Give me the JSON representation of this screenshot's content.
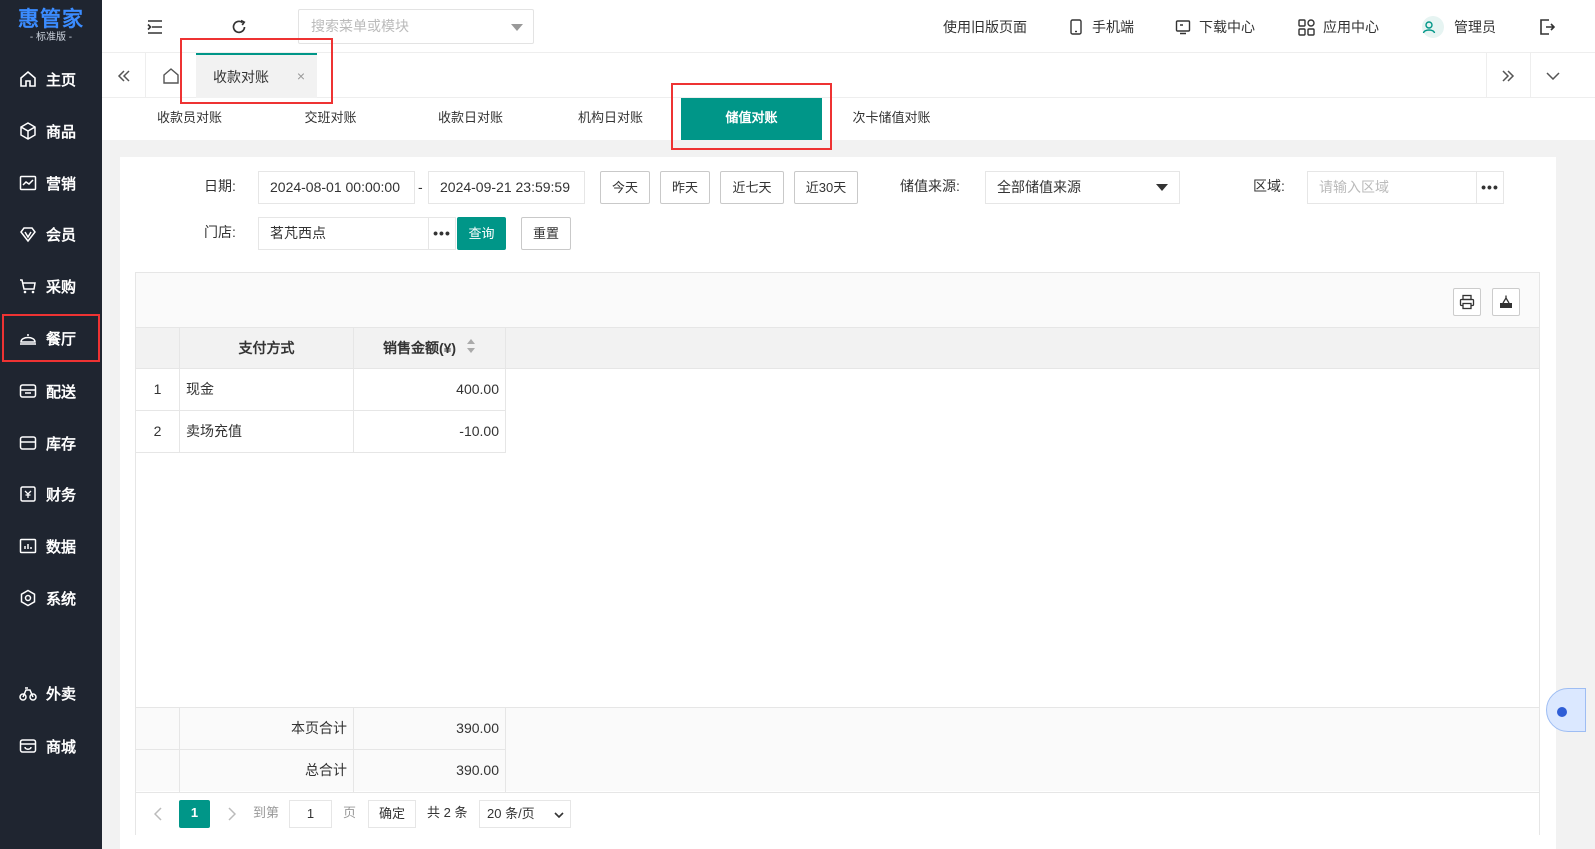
{
  "logo": {
    "main": "惠管家",
    "sub": "- 标准版 -"
  },
  "sidebar": {
    "items": [
      {
        "label": "主页",
        "icon": "home-icon"
      },
      {
        "label": "商品",
        "icon": "box-icon"
      },
      {
        "label": "营销",
        "icon": "chart-icon"
      },
      {
        "label": "会员",
        "icon": "diamond-icon"
      },
      {
        "label": "采购",
        "icon": "cart-icon"
      },
      {
        "label": "餐厅",
        "icon": "cloche-icon"
      },
      {
        "label": "配送",
        "icon": "truck-icon"
      },
      {
        "label": "库存",
        "icon": "storage-icon"
      },
      {
        "label": "财务",
        "icon": "finance-icon"
      },
      {
        "label": "数据",
        "icon": "data-icon"
      },
      {
        "label": "系统",
        "icon": "settings-icon"
      },
      {
        "label": "外卖",
        "icon": "bike-icon"
      },
      {
        "label": "商城",
        "icon": "shop-icon"
      }
    ]
  },
  "topbar": {
    "search_placeholder": "搜索菜单或模块",
    "old_page": "使用旧版页面",
    "mobile": "手机端",
    "download": "下载中心",
    "apps": "应用中心",
    "user": "管理员"
  },
  "tabs": {
    "active_label": "收款对账",
    "close": "×"
  },
  "subtabs": {
    "items": [
      "收款员对账",
      "交班对账",
      "收款日对账",
      "机构日对账",
      "储值对账",
      "次卡储值对账"
    ],
    "active": "储值对账"
  },
  "filters": {
    "date_label": "日期:",
    "date_start": "2024-08-01 00:00:00",
    "date_sep": "-",
    "date_end": "2024-09-21 23:59:59",
    "quick": [
      "今天",
      "昨天",
      "近七天",
      "近30天"
    ],
    "source_label": "储值来源:",
    "source_value": "全部储值来源",
    "region_label": "区域:",
    "region_placeholder": "请输入区域",
    "store_label": "门店:",
    "store_value": "茗芃西点",
    "query": "查询",
    "reset": "重置",
    "more": "•••"
  },
  "table": {
    "columns": [
      "支付方式",
      "销售金额(¥)"
    ],
    "rows": [
      {
        "idx": "1",
        "method": "现金",
        "amount": "400.00"
      },
      {
        "idx": "2",
        "method": "卖场充值",
        "amount": "-10.00"
      }
    ],
    "footer": [
      {
        "label": "本页合计",
        "amount": "390.00"
      },
      {
        "label": "总合计",
        "amount": "390.00"
      }
    ]
  },
  "pager": {
    "current": "1",
    "goto": "到第",
    "page_input": "1",
    "page_unit": "页",
    "confirm": "确定",
    "total": "共 2 条",
    "per_page": "20 条/页"
  },
  "colors": {
    "accent": "#009688",
    "sidebar_bg": "#1f2530",
    "highlight": "#ee3333"
  }
}
